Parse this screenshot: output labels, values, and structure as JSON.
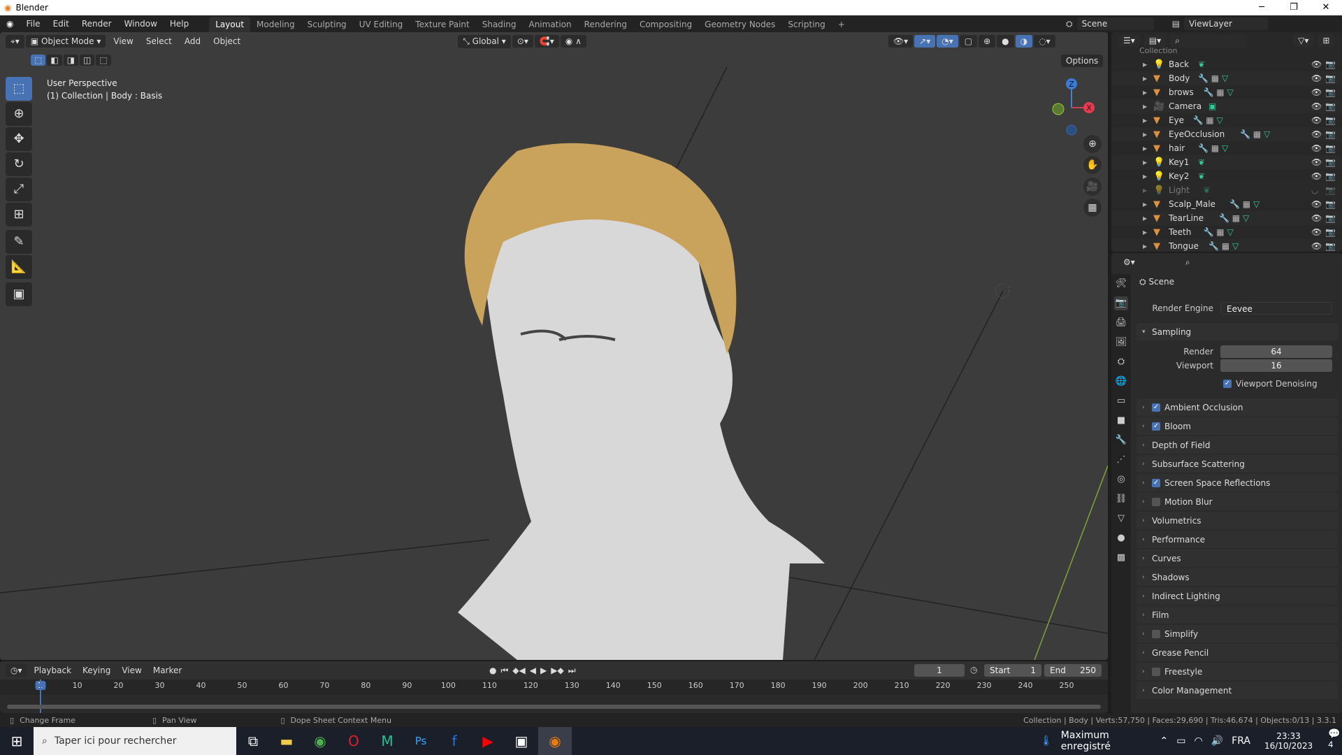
{
  "window": {
    "title": "Blender",
    "min": "─",
    "max": "❐",
    "close": "✕"
  },
  "menu": [
    "File",
    "Edit",
    "Render",
    "Window",
    "Help"
  ],
  "workspaces": [
    "Layout",
    "Modeling",
    "Sculpting",
    "UV Editing",
    "Texture Paint",
    "Shading",
    "Animation",
    "Rendering",
    "Compositing",
    "Geometry Nodes",
    "Scripting",
    "+"
  ],
  "scene": "Scene",
  "viewlayer": "ViewLayer",
  "viewport": {
    "mode": "Object Mode",
    "menus": [
      "View",
      "Select",
      "Add",
      "Object"
    ],
    "orientation": "Global",
    "options": "Options",
    "perspective": "User Perspective",
    "context": "(1) Collection | Body : Basis",
    "gizmo": {
      "z": "Z",
      "x": "X"
    }
  },
  "outliner": {
    "collection": "Collection",
    "items": [
      {
        "name": "Back",
        "type": "light"
      },
      {
        "name": "Body",
        "type": "mesh"
      },
      {
        "name": "brows",
        "type": "mesh"
      },
      {
        "name": "Camera",
        "type": "camera"
      },
      {
        "name": "Eye",
        "type": "mesh"
      },
      {
        "name": "EyeOcclusion",
        "type": "mesh"
      },
      {
        "name": "hair",
        "type": "mesh"
      },
      {
        "name": "Key1",
        "type": "light"
      },
      {
        "name": "Key2",
        "type": "light"
      },
      {
        "name": "Light",
        "type": "light",
        "hidden": true
      },
      {
        "name": "Scalp_Male",
        "type": "mesh"
      },
      {
        "name": "TearLine",
        "type": "mesh"
      },
      {
        "name": "Teeth",
        "type": "mesh"
      },
      {
        "name": "Tongue",
        "type": "mesh"
      }
    ]
  },
  "properties": {
    "header": "Scene",
    "render_engine_label": "Render Engine",
    "render_engine": "Eevee",
    "sampling": "Sampling",
    "render_label": "Render",
    "render_value": "64",
    "viewport_label": "Viewport",
    "viewport_value": "16",
    "denoise": "Viewport Denoising",
    "panels": [
      {
        "label": "Ambient Occlusion",
        "check": true
      },
      {
        "label": "Bloom",
        "check": true
      },
      {
        "label": "Depth of Field"
      },
      {
        "label": "Subsurface Scattering"
      },
      {
        "label": "Screen Space Reflections",
        "check": true
      },
      {
        "label": "Motion Blur",
        "check": false
      },
      {
        "label": "Volumetrics"
      },
      {
        "label": "Performance"
      },
      {
        "label": "Curves"
      },
      {
        "label": "Shadows"
      },
      {
        "label": "Indirect Lighting"
      },
      {
        "label": "Film"
      },
      {
        "label": "Simplify",
        "check": false
      },
      {
        "label": "Grease Pencil"
      },
      {
        "label": "Freestyle",
        "check": false
      },
      {
        "label": "Color Management"
      }
    ]
  },
  "timeline": {
    "menus": [
      "Playback",
      "Keying",
      "View",
      "Marker"
    ],
    "current": "1",
    "start_label": "Start",
    "start": "1",
    "end_label": "End",
    "end": "250",
    "ticks": [
      "1",
      "10",
      "20",
      "30",
      "40",
      "50",
      "60",
      "70",
      "80",
      "90",
      "100",
      "110",
      "120",
      "130",
      "140",
      "150",
      "160",
      "170",
      "180",
      "190",
      "200",
      "210",
      "220",
      "230",
      "240",
      "250"
    ]
  },
  "status": {
    "left": "Change Frame",
    "mid": "Pan View",
    "ctx": "Dope Sheet Context Menu",
    "stats": "Collection | Body | Verts:57,750 | Faces:29,690 | Tris:46,674 | Objects:0/13 | 3.3.1"
  },
  "taskbar": {
    "search": "Taper ici pour rechercher",
    "weather": "Maximum enregistré",
    "lang": "FRA",
    "time": "23:33",
    "date": "16/10/2023",
    "notif": "4"
  }
}
